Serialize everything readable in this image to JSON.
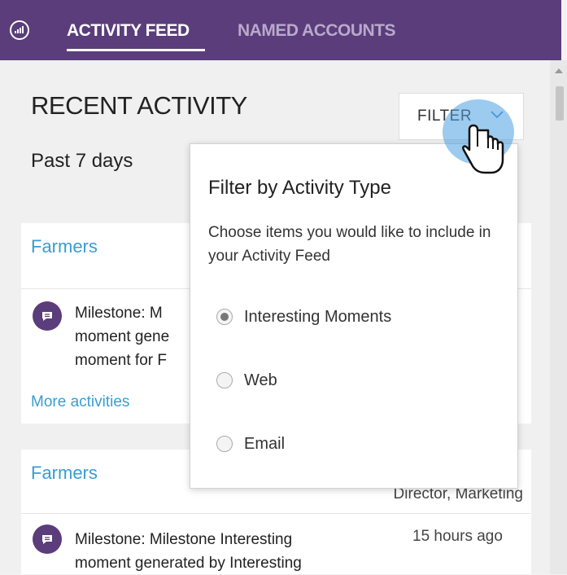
{
  "nav": {
    "tabs": [
      {
        "label": "ACTIVITY FEED",
        "active": true
      },
      {
        "label": "NAMED ACCOUNTS",
        "active": false
      }
    ],
    "logo_icon": "chart-circle-icon"
  },
  "header": {
    "title": "RECENT ACTIVITY",
    "period": "Past 7 days",
    "filter_label": "FILTER",
    "filter_icon": "chevron-down-icon"
  },
  "cards": [
    {
      "account": "Farmers",
      "activity": "Milestone: Milestone Interesting moment generated by Interesting moment for Farmers",
      "activity_visible_lines": [
        "Milestone: M",
        "moment gene",
        "moment for F"
      ],
      "more_link": "More activities"
    },
    {
      "account": "Farmers",
      "role": "Director, Marketing",
      "activity_lines": [
        "Milestone: Milestone Interesting",
        "moment generated by Interesting"
      ],
      "time": "15 hours ago"
    }
  ],
  "filter_dropdown": {
    "heading": "Filter by Activity Type",
    "description": "Choose items you would like to include in your Activity Feed",
    "options": [
      {
        "label": "Interesting Moments",
        "checked": true
      },
      {
        "label": "Web",
        "checked": false
      },
      {
        "label": "Email",
        "checked": false
      }
    ]
  },
  "colors": {
    "nav_bg": "#5a3d7a",
    "link": "#3a9dd1",
    "accent_highlight": "#4ba0e1"
  }
}
